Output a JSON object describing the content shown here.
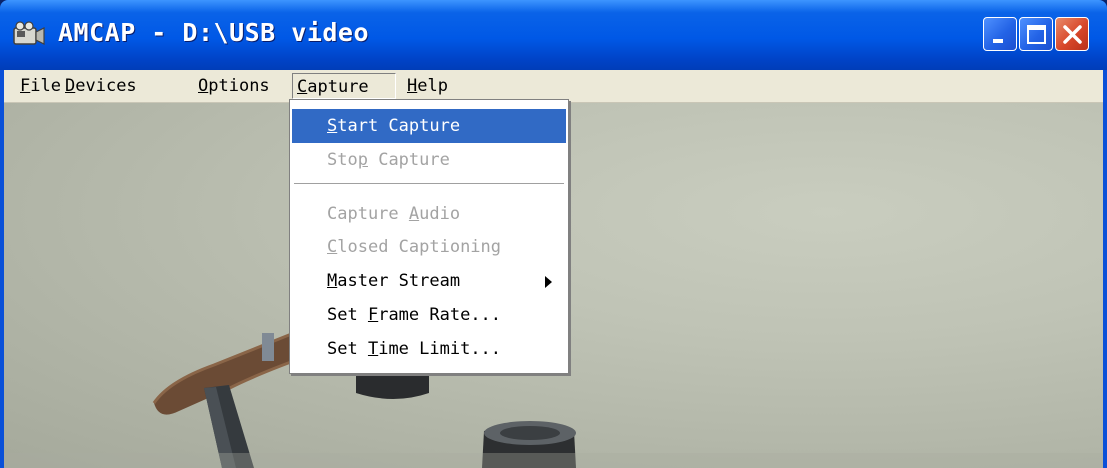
{
  "window": {
    "title": "AMCAP - D:\\USB video",
    "controls": {
      "minimize_icon": "minimize-icon",
      "maximize_icon": "maximize-icon",
      "close_icon": "close-icon"
    }
  },
  "menubar": {
    "items": [
      {
        "label": "File",
        "mnemonic": "F"
      },
      {
        "label": "Devices",
        "mnemonic": "D"
      },
      {
        "label": "Options",
        "mnemonic": "O"
      },
      {
        "label": "Capture",
        "mnemonic": "C",
        "open": true
      },
      {
        "label": "Help",
        "mnemonic": "H"
      }
    ]
  },
  "capture_menu": {
    "items": [
      {
        "label": "Start Capture",
        "state": "selected"
      },
      {
        "label": "Stop Capture",
        "state": "disabled"
      },
      {
        "label": "Capture Audio",
        "state": "disabled"
      },
      {
        "label": "Closed Captioning",
        "state": "disabled"
      },
      {
        "label": "Master Stream",
        "state": "enabled",
        "has_submenu": true
      },
      {
        "label": "Set Frame Rate...",
        "state": "enabled"
      },
      {
        "label": "Set Time Limit...",
        "state": "enabled"
      }
    ]
  },
  "colors": {
    "titlebar": "#0058e6",
    "menu_highlight": "#316ac5",
    "disabled_text": "#a3a3a3",
    "close_button": "#d8472a"
  }
}
